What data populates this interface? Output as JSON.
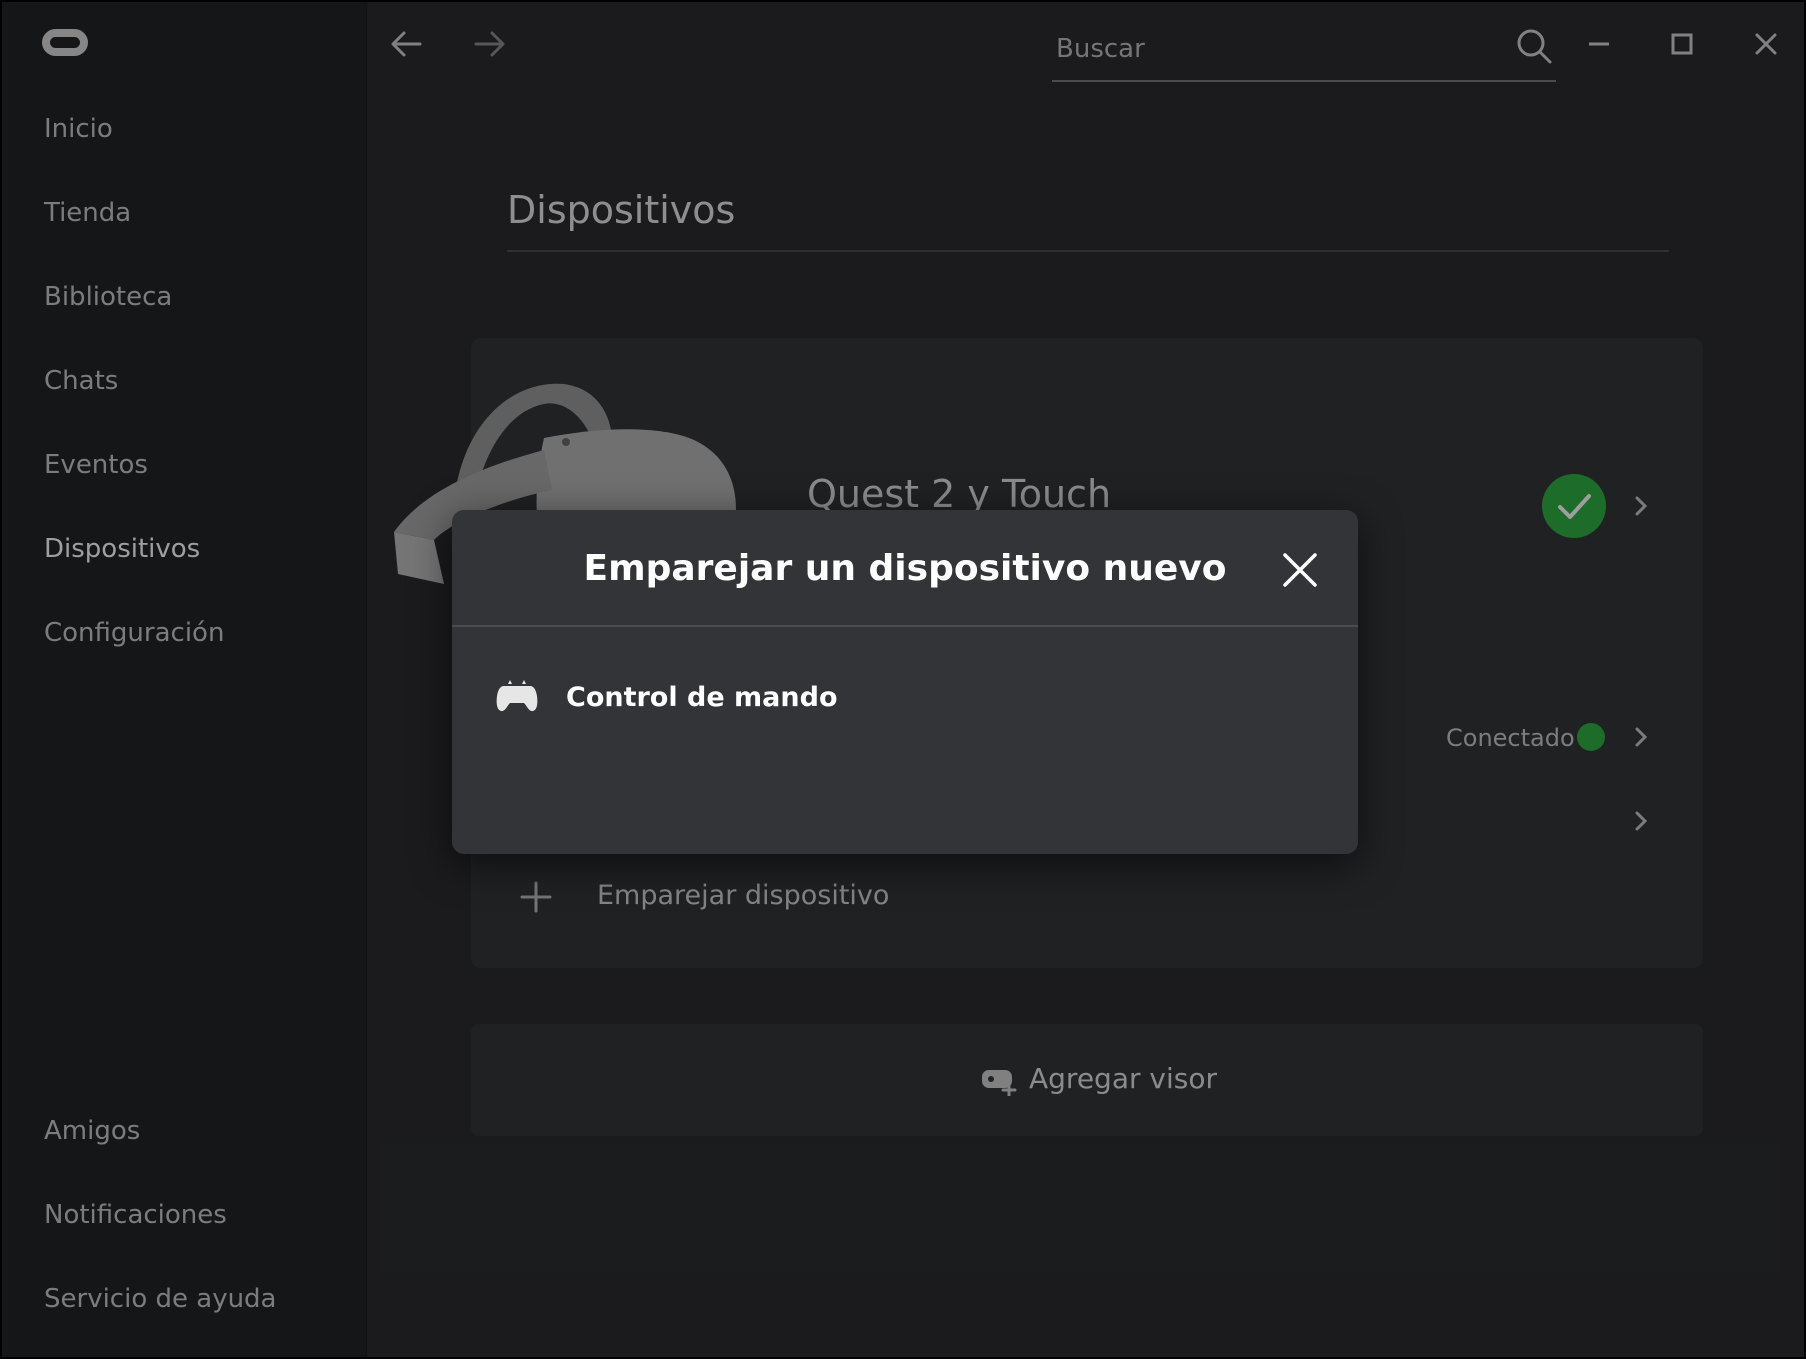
{
  "sidebar": {
    "items": [
      {
        "label": "Inicio"
      },
      {
        "label": "Tienda"
      },
      {
        "label": "Biblioteca"
      },
      {
        "label": "Chats"
      },
      {
        "label": "Eventos"
      },
      {
        "label": "Dispositivos",
        "active": true
      },
      {
        "label": "Configuración"
      }
    ],
    "bottom_items": [
      {
        "label": "Amigos"
      },
      {
        "label": "Notificaciones"
      },
      {
        "label": "Servicio de ayuda"
      }
    ]
  },
  "topbar": {
    "search": {
      "placeholder": "Buscar",
      "value": ""
    },
    "back_icon": "arrow-left-icon",
    "forward_icon": "arrow-right-icon",
    "window_controls": [
      "minimize-icon",
      "maximize-icon",
      "close-icon"
    ]
  },
  "main": {
    "title": "Dispositivos",
    "device": {
      "name": "Quest 2 y Touch",
      "status_icon": "check-icon",
      "connection_label": "Conectado"
    },
    "pair_device_label": "Emparejar dispositivo",
    "add_headset_label": "Agregar visor"
  },
  "modal": {
    "title": "Emparejar un dispositivo nuevo",
    "items": [
      {
        "label": "Control de mando",
        "icon": "gamepad-icon"
      }
    ]
  },
  "colors": {
    "sidebar_bg": "#232427",
    "content_bg": "#2c2d2f",
    "card_bg": "#353639",
    "modal_bg": "#333437",
    "success": "#2fae44"
  }
}
